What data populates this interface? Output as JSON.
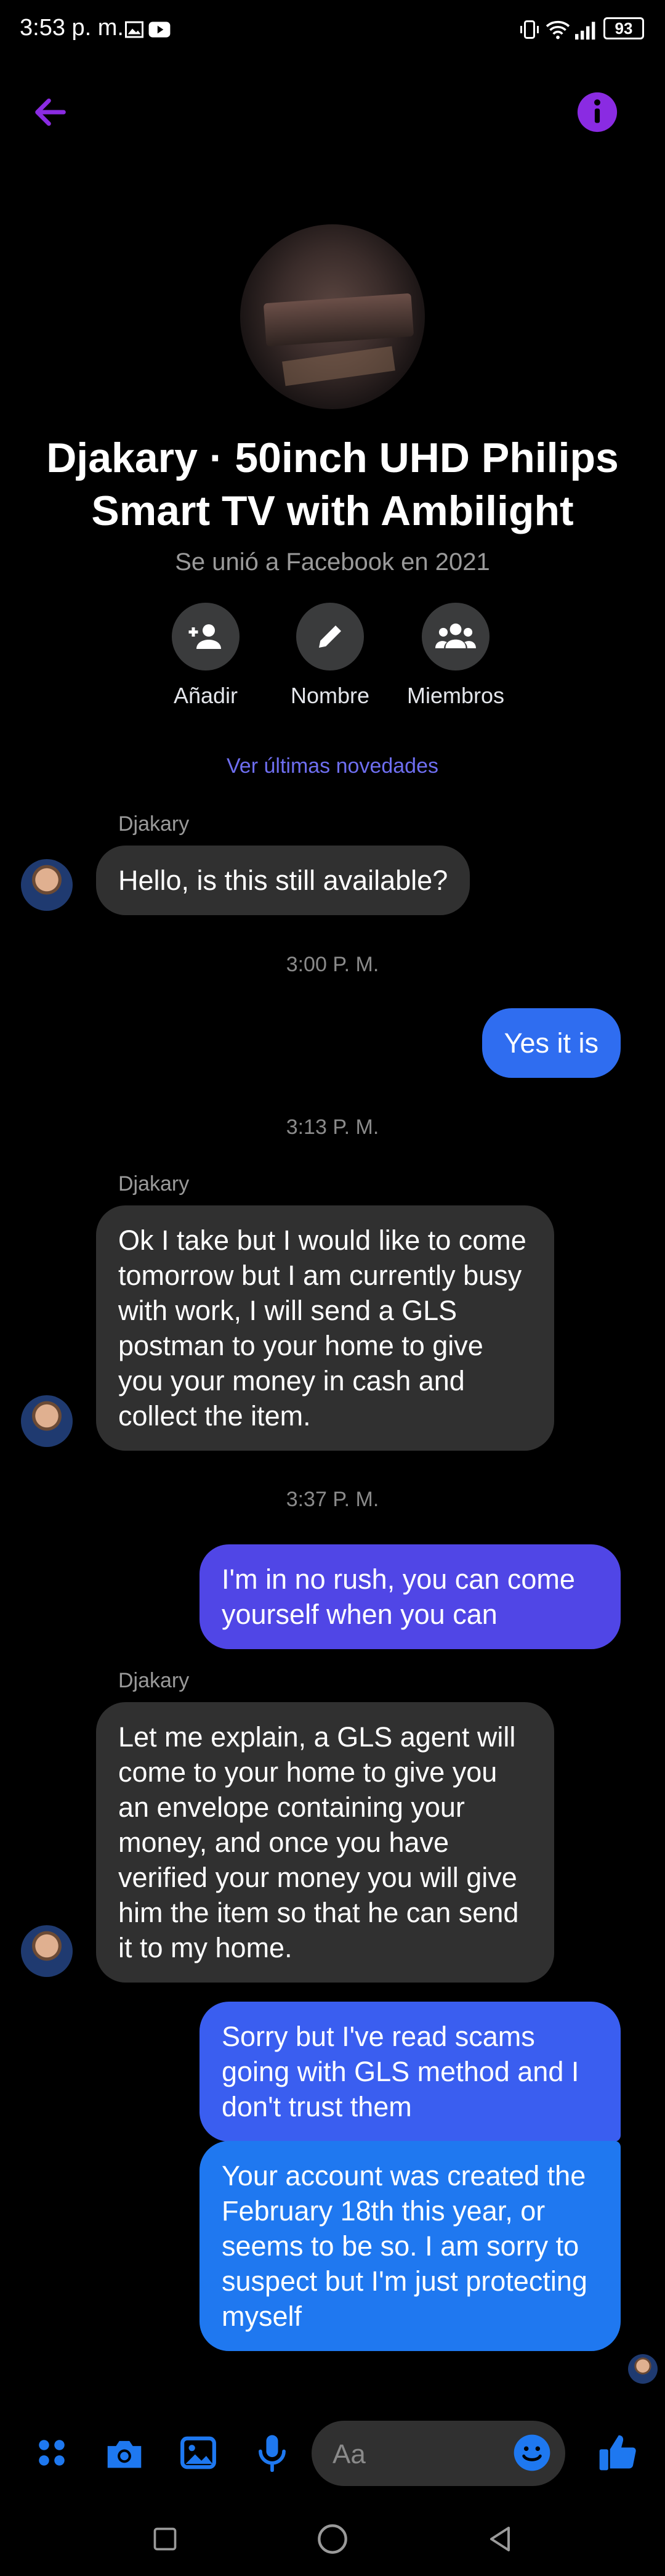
{
  "status_bar": {
    "time": "3:53 p. m.",
    "battery": "93"
  },
  "header": {
    "back_icon": "arrow-left-icon",
    "info_icon": "info-icon"
  },
  "profile": {
    "title": "Djakary · 50inch UHD Philips Smart TV with Ambilight",
    "subtitle": "Se unió a Facebook en 2021",
    "actions": [
      {
        "label": "Añadir",
        "icon": "add-person-icon"
      },
      {
        "label": "Nombre",
        "icon": "pencil-icon"
      },
      {
        "label": "Miembros",
        "icon": "group-icon"
      }
    ],
    "news_link": "Ver últimas novedades"
  },
  "messages": {
    "m1": {
      "sender": "Djakary",
      "text": "Hello, is this still available?"
    },
    "ts1": "3:00 P. M.",
    "m2": {
      "text": "Yes it is"
    },
    "ts2": "3:13 P. M.",
    "m3": {
      "sender": "Djakary",
      "text": "Ok I take but I would like to come tomorrow but I am currently busy with work, I will send a GLS postman to your home to give you your money in cash and collect the item."
    },
    "ts3": "3:37 P. M.",
    "m4": {
      "text": "I'm in no rush, you can come yourself when you can"
    },
    "m5": {
      "sender": "Djakary",
      "text": "Let me explain, a GLS agent will come to your home to give you an envelope containing your money, and once you have verified your money you will give him the item so that he can send it to my home."
    },
    "m6": {
      "text": "Sorry but I've read scams going with GLS method and I don't trust them"
    },
    "m7": {
      "text": "Your account was created the February 18th this year, or seems to be so. I am sorry to suspect but I'm just protecting myself"
    }
  },
  "composer": {
    "placeholder": "Aa"
  },
  "colors": {
    "accent": "#8a2be2",
    "out_bubble_top": "#5b4ef0",
    "out_bubble_bottom": "#1e78f0",
    "in_bubble": "#303030"
  }
}
